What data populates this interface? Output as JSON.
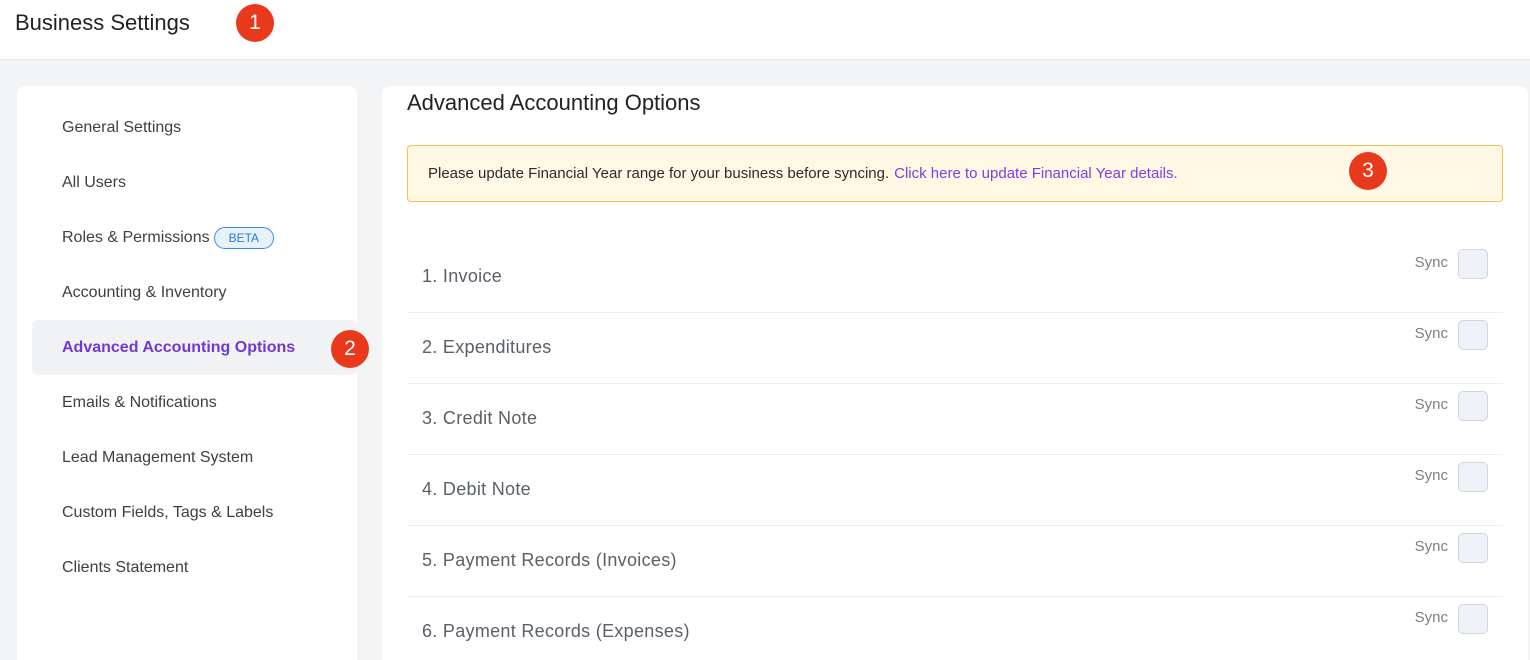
{
  "header": {
    "title": "Business Settings"
  },
  "badges": {
    "b1": "1",
    "b2": "2",
    "b3": "3"
  },
  "sidebar": {
    "items": [
      {
        "label": "General Settings"
      },
      {
        "label": "All Users"
      },
      {
        "label": "Roles & Permissions",
        "tag": "BETA"
      },
      {
        "label": "Accounting & Inventory"
      },
      {
        "label": "Advanced Accounting Options",
        "active": true
      },
      {
        "label": "Emails & Notifications"
      },
      {
        "label": "Lead Management System"
      },
      {
        "label": "Custom Fields, Tags & Labels"
      },
      {
        "label": "Clients Statement"
      }
    ]
  },
  "main": {
    "title": "Advanced Accounting Options",
    "alert": {
      "text": "Please update Financial Year range for your business before syncing.",
      "link": "Click here to update Financial Year details."
    },
    "sync_label": "Sync",
    "rows": [
      {
        "label": "1. Invoice",
        "checked": false
      },
      {
        "label": "2. Expenditures",
        "checked": false
      },
      {
        "label": "3. Credit Note",
        "checked": false
      },
      {
        "label": "4. Debit Note",
        "checked": false
      },
      {
        "label": "5. Payment Records (Invoices)",
        "checked": false
      },
      {
        "label": "6. Payment Records (Expenses)",
        "checked": false
      }
    ]
  },
  "colors": {
    "accent": "#7238d4",
    "badge": "#e8391c",
    "alert_bg": "#fff8e5",
    "alert_border": "#f1c44d"
  }
}
